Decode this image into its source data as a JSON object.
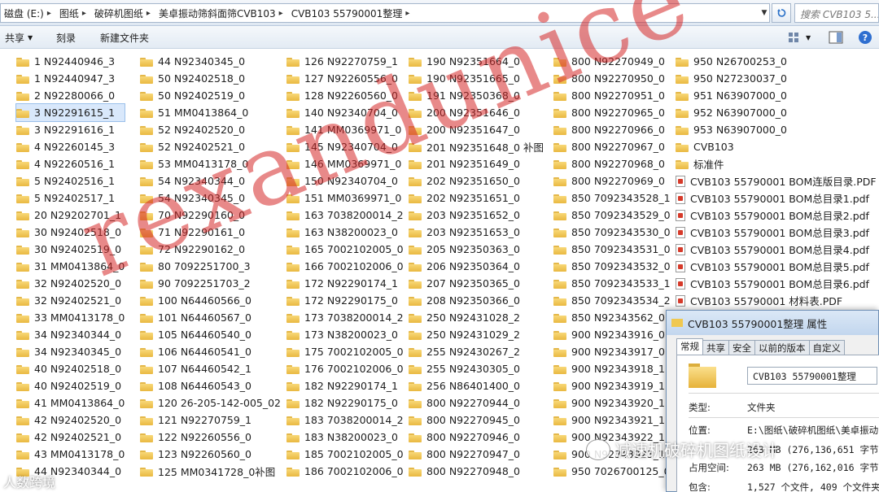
{
  "address": {
    "crumbs": [
      "磁盘 (E:)",
      "图纸",
      "破碎机图纸",
      "美卓振动筛斜面筛CVB103",
      "CVB103 55790001整理"
    ],
    "search_placeholder": "搜索 CVB103 5..."
  },
  "toolbar": {
    "share": "共享",
    "burn": "刻录",
    "new_folder": "新建文件夹"
  },
  "columns": [
    [
      "1  N92440946_3",
      "1  N92440947_3",
      "2  N92280066_0",
      "3  N92291615_1",
      "3  N92291616_1",
      "4  N92260145_3",
      "4  N92260516_1",
      "5  N92402516_1",
      "5  N92402517_1",
      "20  N29202701_1",
      "30  N92402518_0",
      "30  N92402519_0",
      "31  MM0413864_0",
      "32  N92402520_0",
      "32  N92402521_0",
      "33  MM0413178_0",
      "34  N92340344_0",
      "34  N92340345_0",
      "40  N92402518_0",
      "40  N92402519_0",
      "41  MM0413864_0",
      "42  N92402520_0",
      "42  N92402521_0",
      "43  MM0413178_0",
      "44  N92340344_0"
    ],
    [
      "44  N92340345_0",
      "50  N92402518_0",
      "50  N92402519_0",
      "51  MM0413864_0",
      "52  N92402520_0",
      "52  N92402521_0",
      "53  MM0413178_0",
      "54  N92340344_0",
      "54  N92340345_0",
      "70  N92290160_0",
      "71  N92290161_0",
      "72  N92290162_0",
      "80  7092251700_3",
      "90  7092251703_2",
      "100  N64460566_0",
      "101  N64460567_0",
      "105  N64460540_0",
      "106  N64460541_0",
      "107  N64460542_1",
      "108  N64460543_0",
      "120  26-205-142-005_02",
      "121  N92270759_1",
      "122  N92260556_0",
      "123  N92260560_0",
      "125  MM0341728_0补图"
    ],
    [
      "126  N92270759_1",
      "127  N92260556_0",
      "128  N92260560_0",
      "140  N92340704_0",
      "141  MM0369971_0",
      "145  N92340704_0",
      "146  MM0369971_0",
      "150  N92340704_0",
      "151  MM0369971_0",
      "163  7038200014_2",
      "163  N38200023_0",
      "165  7002102005_0",
      "166  7002102006_0",
      "172  N92290174_1",
      "172  N92290175_0",
      "173  7038200014_2",
      "173  N38200023_0",
      "175  7002102005_0",
      "176  7002102006_0",
      "182  N92290174_1",
      "182  N92290175_0",
      "183  7038200014_2",
      "183  N38200023_0",
      "185  7002102005_0",
      "186  7002102006_0"
    ],
    [
      "190  N92351664_0",
      "190  N92351665_0",
      "191  N92350368_0",
      "200  N92351646_0",
      "200  N92351647_0",
      "201  N92351648_0  补图",
      "201  N92351649_0",
      "202  N92351650_0",
      "202  N92351651_0",
      "203  N92351652_0",
      "203  N92351653_0",
      "205  N92350363_0",
      "206  N92350364_0",
      "207  N92350365_0",
      "208  N92350366_0",
      "250  N92431028_2",
      "250  N92431029_2",
      "255  N92430267_2",
      "255  N92430305_0",
      "256  N86401400_0",
      "800  N92270944_0",
      "800  N92270945_0",
      "800  N92270946_0",
      "800  N92270947_0",
      "800  N92270948_0"
    ],
    [
      "800  N92270949_0",
      "800  N92270950_0",
      "800  N92270951_0",
      "800  N92270965_0",
      "800  N92270966_0",
      "800  N92270967_0",
      "800  N92270968_0",
      "800  N92270969_0",
      "850  7092343528_1",
      "850  7092343529_0",
      "850  7092343530_0",
      "850  7092343531_0",
      "850  7092343532_0",
      "850  7092343533_1",
      "850  7092343534_2",
      "850  N92343562_0",
      "900  N92343916_0",
      "900  N92343917_0",
      "900  N92343918_1",
      "900  N92343919_1",
      "900  N92343920_1",
      "900  N92343921_1",
      "900  N92343922_1",
      "900  N92343923_1",
      "950  7026700125_0"
    ],
    [
      "950  N26700253_0",
      "950  N27230037_0",
      "951  N63907000_0",
      "952  N63907000_0",
      "953  N63907000_0",
      "CVB103",
      "标准件",
      "CVB103 55790001 BOM连版目录.PDF",
      "CVB103 55790001 BOM总目录1.pdf",
      "CVB103 55790001 BOM总目录2.pdf",
      "CVB103 55790001 BOM总目录3.pdf",
      "CVB103 55790001 BOM总目录4.pdf",
      "CVB103 55790001 BOM总目录5.pdf",
      "CVB103 55790001 BOM总目录6.pdf",
      "CVB103 55790001 材料表.PDF"
    ]
  ],
  "watermark": "rexandunice",
  "dialog": {
    "title": "CVB103 55790001整理 属性",
    "tabs": [
      "常规",
      "共享",
      "安全",
      "以前的版本",
      "自定义"
    ],
    "name": "CVB103 55790001整理",
    "type_label": "类型:",
    "type_value": "文件夹",
    "loc_label": "位置:",
    "loc_value": "E:\\图纸\\破碎机图纸\\美卓振动",
    "size_value": "263 MB (276,136,651 字节)",
    "disk_label": "占用空间:",
    "disk_value": "263 MB (276,162,016 字节)",
    "contains_label": "包含:",
    "contains_value": "1,527 个文件, 409 个文件夹"
  },
  "overlay": {
    "wechat": "减速机破碎机图纸设计",
    "corner": "人数跨境"
  }
}
